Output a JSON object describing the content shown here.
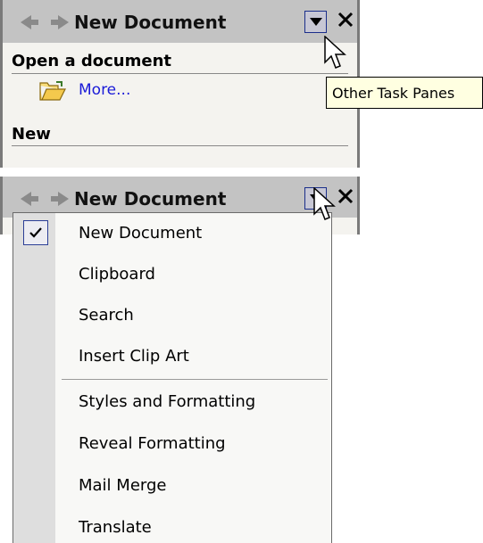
{
  "top_pane": {
    "title": "New Document",
    "section_open": "Open a document",
    "more_link": "More...",
    "section_new": "New",
    "tooltip": "Other Task Panes"
  },
  "bottom_pane": {
    "title": "New Document",
    "menu": {
      "items": [
        {
          "label": "New Document",
          "checked": true
        },
        {
          "label": "Clipboard"
        },
        {
          "label": "Search"
        },
        {
          "label": "Insert Clip Art"
        },
        {
          "label": "Styles and Formatting"
        },
        {
          "label": "Reveal Formatting"
        },
        {
          "label": "Mail Merge"
        },
        {
          "label": "Translate"
        }
      ]
    }
  },
  "colors": {
    "titlebar": "#c3c3c3",
    "pane_bg": "#f4f3ef",
    "link": "#1a1ad8",
    "tooltip_bg": "#ffffe1",
    "button_border": "#1a2e8a"
  },
  "icons": [
    "back-arrow-icon",
    "forward-arrow-icon",
    "dropdown-arrow-icon",
    "close-icon",
    "folder-open-icon",
    "checkmark-icon",
    "mouse-cursor-icon"
  ]
}
